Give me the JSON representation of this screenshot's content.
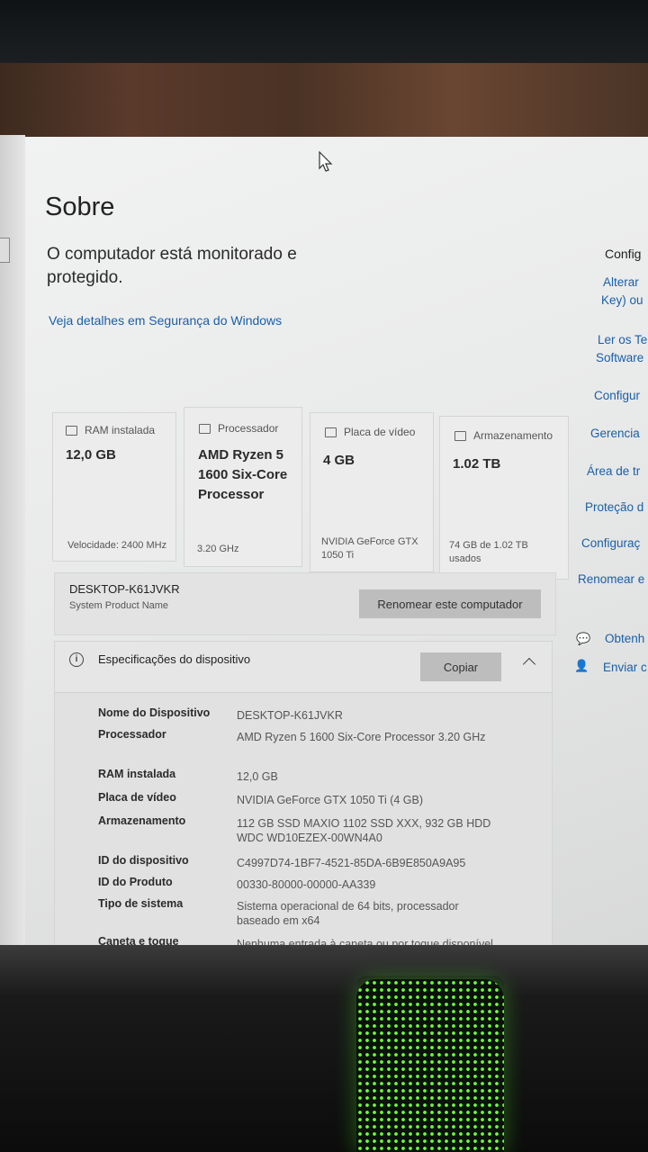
{
  "page": {
    "title": "Sobre",
    "status_line": "O computador está monitorado e protegido.",
    "security_link": "Veja detalhes em Segurança do Windows"
  },
  "cards": [
    {
      "icon": "ram-icon",
      "label": "RAM instalada",
      "value": "12,0 GB",
      "detail": "Velocidade: 2400 MHz"
    },
    {
      "icon": "processor-icon",
      "label": "Processador",
      "value": "AMD Ryzen 5 1600 Six-Core Processor",
      "detail": "3.20 GHz"
    },
    {
      "icon": "gpu-icon",
      "label": "Placa de vídeo",
      "value": "4 GB",
      "detail": "NVIDIA GeForce GTX 1050 Ti"
    },
    {
      "icon": "storage-icon",
      "label": "Armazenamento",
      "value": "1.02 TB",
      "detail": "74 GB de 1.02 TB usados"
    }
  ],
  "device": {
    "name": "DESKTOP-K61JVKR",
    "model": "System Product Name",
    "rename_button": "Renomear este computador"
  },
  "specs": {
    "title": "Especificações do dispositivo",
    "copy_button": "Copiar",
    "rows": [
      {
        "label": "Nome do Dispositivo",
        "value": "DESKTOP-K61JVKR"
      },
      {
        "label": "Processador",
        "value": "AMD Ryzen 5 1600 Six-Core Processor 3.20 GHz"
      },
      {
        "label": "RAM instalada",
        "value": "12,0 GB"
      },
      {
        "label": "Placa de vídeo",
        "value": "NVIDIA GeForce GTX 1050 Ti (4 GB)"
      },
      {
        "label": "Armazenamento",
        "value": "112 GB SSD MAXIO 1102 SSD XXX, 932 GB HDD WDC WD10EZEX-00WN4A0"
      },
      {
        "label": "ID do dispositivo",
        "value": "C4997D74-1BF7-4521-85DA-6B9E850A9A95"
      },
      {
        "label": "ID do Produto",
        "value": "00330-80000-00000-AA339"
      },
      {
        "label": "Tipo de sistema",
        "value": "Sistema operacional de 64 bits, processador baseado em x64"
      },
      {
        "label": "Caneta e toque",
        "value": "Nenhuma entrada à caneta ou por toque disponível para este vídeo"
      }
    ]
  },
  "right_panel": {
    "heading": "Config",
    "links": [
      "Alterar",
      "Key) ou",
      "Ler os Te",
      "Software",
      "Configur",
      "Gerencia",
      "Área de tr",
      "Proteção d",
      "Configuraç",
      "Renomear e"
    ],
    "help": "Obtenh",
    "feedback": "Enviar c"
  }
}
